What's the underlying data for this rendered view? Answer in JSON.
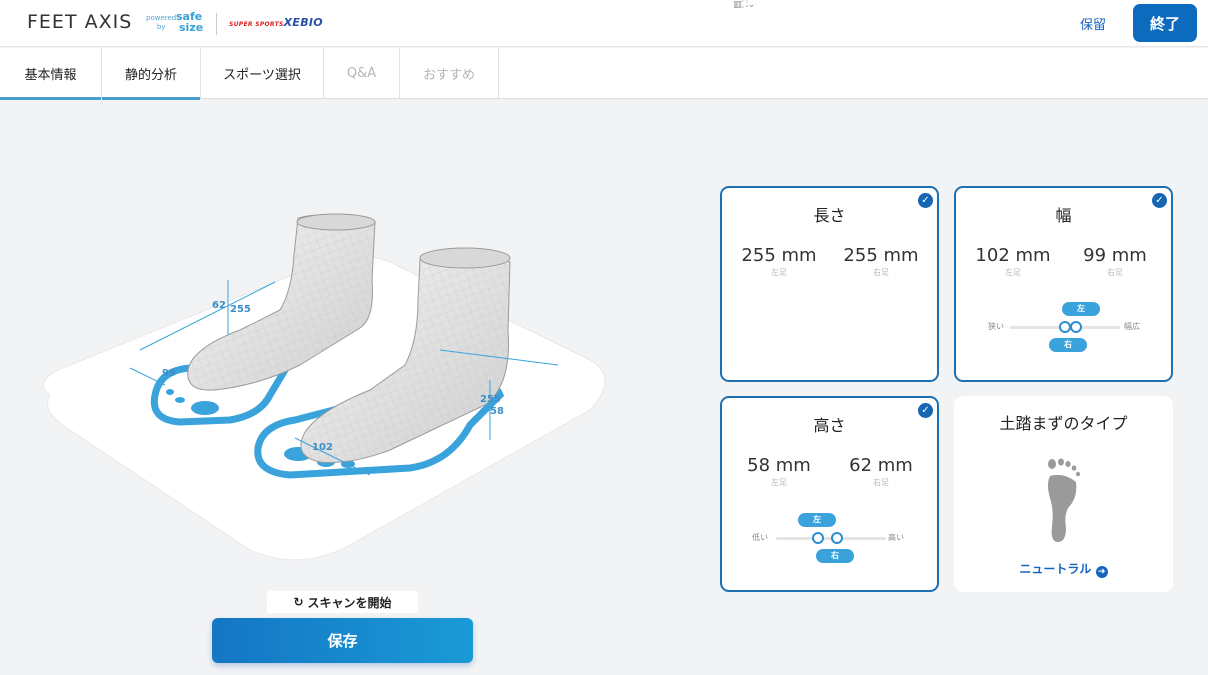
{
  "header": {
    "brand": "FEET AXIS",
    "powered_line1": "powered",
    "powered_line2": "by",
    "safe": "safe",
    "size": "size",
    "partner_red": "SUPER SPORTS",
    "partner_blue": "XEBIO",
    "window_handle": "▥⛶⌄",
    "hold_label": "保留",
    "end_label": "終了"
  },
  "tabs": [
    {
      "label": "基本情報",
      "state": "active"
    },
    {
      "label": "静的分析",
      "state": "active"
    },
    {
      "label": "スポーツ選択",
      "state": "enabled"
    },
    {
      "label": "Q&A",
      "state": "disabled"
    },
    {
      "label": "おすすめ",
      "state": "disabled"
    }
  ],
  "scene": {
    "dims": {
      "a": "62",
      "b": "255",
      "c": "99",
      "d": "255",
      "e": "58",
      "f": "102"
    }
  },
  "actions": {
    "scan_label": "スキャンを開始",
    "save_label": "保存"
  },
  "cards": {
    "length": {
      "title": "長さ",
      "left_value": "255 mm",
      "left_label": "左足",
      "right_value": "255 mm",
      "right_label": "右足",
      "checked": true
    },
    "width": {
      "title": "幅",
      "left_value": "102 mm",
      "left_label": "左足",
      "right_value": "99 mm",
      "right_label": "右足",
      "min_label": "狭い",
      "max_label": "幅広",
      "left_tag": "左",
      "right_tag": "右",
      "left_level": 0.5,
      "right_level": 0.6,
      "checked": true
    },
    "height": {
      "title": "高さ",
      "left_value": "58 mm",
      "left_label": "左足",
      "right_value": "62 mm",
      "right_label": "右足",
      "min_label": "低い",
      "max_label": "高い",
      "left_tag": "左",
      "right_tag": "右",
      "left_level": 0.38,
      "right_level": 0.55,
      "checked": true
    },
    "arch": {
      "title": "土踏まずのタイプ",
      "type_label": "ニュートラル",
      "icon": "footprint-icon"
    }
  },
  "colors": {
    "accent": "#1b6fb3",
    "scan_blue": "#3aa3dc"
  }
}
